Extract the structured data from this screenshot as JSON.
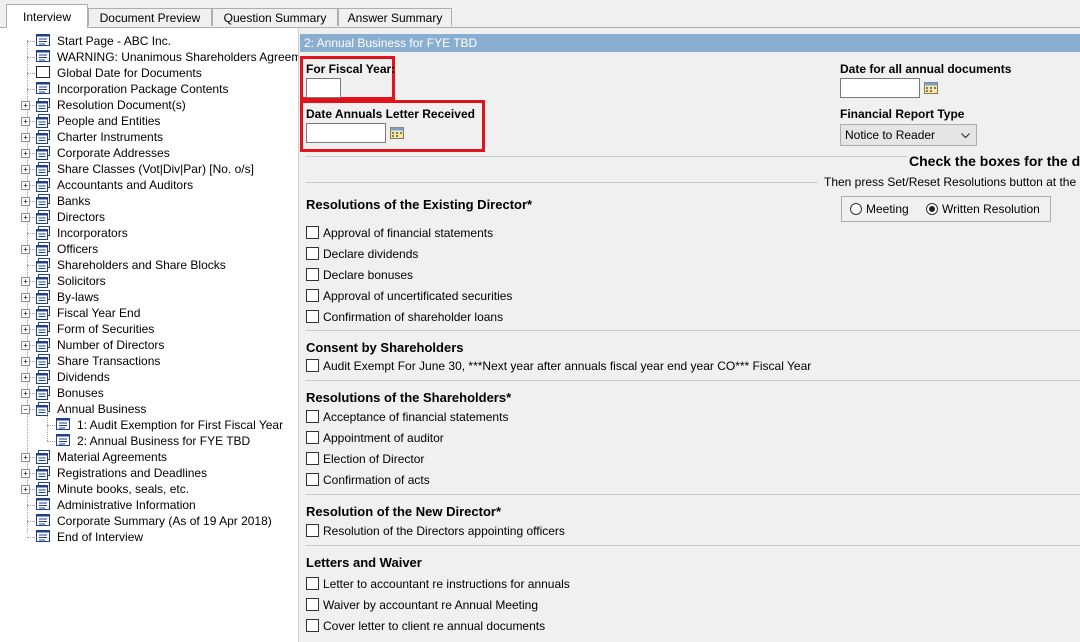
{
  "tabs": [
    {
      "label": "Interview",
      "active": true
    },
    {
      "label": "Document Preview",
      "active": false
    },
    {
      "label": "Question Summary",
      "active": false
    },
    {
      "label": "Answer Summary",
      "active": false
    }
  ],
  "tree": [
    {
      "label": "Start Page - ABC Inc.",
      "expander": false,
      "icon": "page-icon"
    },
    {
      "label": "WARNING: Unanimous Shareholders Agreem",
      "expander": false,
      "icon": "page-icon"
    },
    {
      "label": "Global Date for Documents",
      "expander": false,
      "icon": "blank-page-icon"
    },
    {
      "label": "Incorporation Package Contents",
      "expander": false,
      "icon": "page-icon"
    },
    {
      "label": "Resolution Document(s)",
      "expander": true,
      "icon": "stack-icon"
    },
    {
      "label": "People and Entities",
      "expander": true,
      "icon": "stack-icon"
    },
    {
      "label": "Charter Instruments",
      "expander": true,
      "icon": "stack-icon"
    },
    {
      "label": "Corporate Addresses",
      "expander": true,
      "icon": "stack-icon"
    },
    {
      "label": "Share Classes (Vot|Div|Par) [No. o/s]",
      "expander": true,
      "icon": "stack-icon"
    },
    {
      "label": "Accountants and Auditors",
      "expander": true,
      "icon": "stack-icon"
    },
    {
      "label": "Banks",
      "expander": true,
      "icon": "stack-icon"
    },
    {
      "label": "Directors",
      "expander": true,
      "icon": "stack-icon"
    },
    {
      "label": "Incorporators",
      "expander": false,
      "icon": "stack-icon"
    },
    {
      "label": "Officers",
      "expander": true,
      "icon": "stack-icon"
    },
    {
      "label": "Shareholders and Share Blocks",
      "expander": false,
      "icon": "stack-icon"
    },
    {
      "label": "Solicitors",
      "expander": true,
      "icon": "stack-icon"
    },
    {
      "label": "By-laws",
      "expander": true,
      "icon": "stack-icon"
    },
    {
      "label": "Fiscal Year End",
      "expander": true,
      "icon": "stack-icon"
    },
    {
      "label": "Form of Securities",
      "expander": true,
      "icon": "stack-icon"
    },
    {
      "label": "Number of Directors",
      "expander": true,
      "icon": "stack-icon"
    },
    {
      "label": "Share Transactions",
      "expander": true,
      "icon": "stack-icon"
    },
    {
      "label": "Dividends",
      "expander": true,
      "icon": "stack-icon"
    },
    {
      "label": "Bonuses",
      "expander": true,
      "icon": "stack-icon"
    },
    {
      "label": "Annual Business",
      "expander": "open",
      "icon": "stack-icon"
    },
    {
      "label": "1: Audit Exemption for First Fiscal Year",
      "expander": false,
      "icon": "page-icon",
      "child": true
    },
    {
      "label": "2: Annual Business for FYE TBD",
      "expander": false,
      "icon": "page-icon",
      "child": true
    },
    {
      "label": "Material Agreements",
      "expander": true,
      "icon": "stack-icon"
    },
    {
      "label": "Registrations and Deadlines",
      "expander": true,
      "icon": "stack-icon"
    },
    {
      "label": "Minute books, seals, etc.",
      "expander": true,
      "icon": "stack-icon"
    },
    {
      "label": "Administrative Information",
      "expander": false,
      "icon": "page-icon"
    },
    {
      "label": "Corporate Summary (As of 19 Apr 2018)",
      "expander": false,
      "icon": "page-icon"
    },
    {
      "label": "End of Interview",
      "expander": false,
      "icon": "page-icon"
    }
  ],
  "form": {
    "header": "2: Annual Business for FYE TBD",
    "fiscal_year_label": "For Fiscal Year:",
    "fiscal_year_value": "",
    "letter_received_label": "Date Annuals Letter Received",
    "letter_received_value": "",
    "date_all_label": "Date for all annual documents",
    "date_all_value": "",
    "report_type_label": "Financial Report Type",
    "report_type_value": "Notice to Reader",
    "instruction_title": "Check the boxes for the d",
    "instruction_sub": "Then press Set/Reset Resolutions button at the b",
    "radio_meeting": "Meeting",
    "radio_written": "Written Resolution",
    "radio_selected": "Written Resolution"
  },
  "sections": [
    {
      "title": "Resolutions of the Existing Director*",
      "items": [
        "Approval of financial statements",
        "Declare dividends",
        "Declare bonuses",
        "Approval of uncertificated securities",
        "Confirmation of shareholder loans"
      ]
    },
    {
      "title": "Consent by Shareholders",
      "items": [
        "Audit Exempt For June 30, ***Next year after annuals fiscal year end year CO*** Fiscal Year"
      ]
    },
    {
      "title": "Resolutions of the Shareholders*",
      "items": [
        "Acceptance of financial statements",
        "Appointment of auditor",
        "Election of Director",
        "Confirmation of acts"
      ]
    },
    {
      "title": "Resolution of the New Director*",
      "items": [
        "Resolution of the Directors appointing officers"
      ]
    },
    {
      "title": "Letters and Waiver",
      "items": [
        "Letter to accountant re instructions for annuals",
        "Waiver by accountant re Annual Meeting",
        "Cover letter to client re annual documents"
      ]
    }
  ],
  "colors": {
    "header_bg": "#8aaed0",
    "highlight": "#e0141c",
    "icon_blue": "#1f3f8f"
  }
}
